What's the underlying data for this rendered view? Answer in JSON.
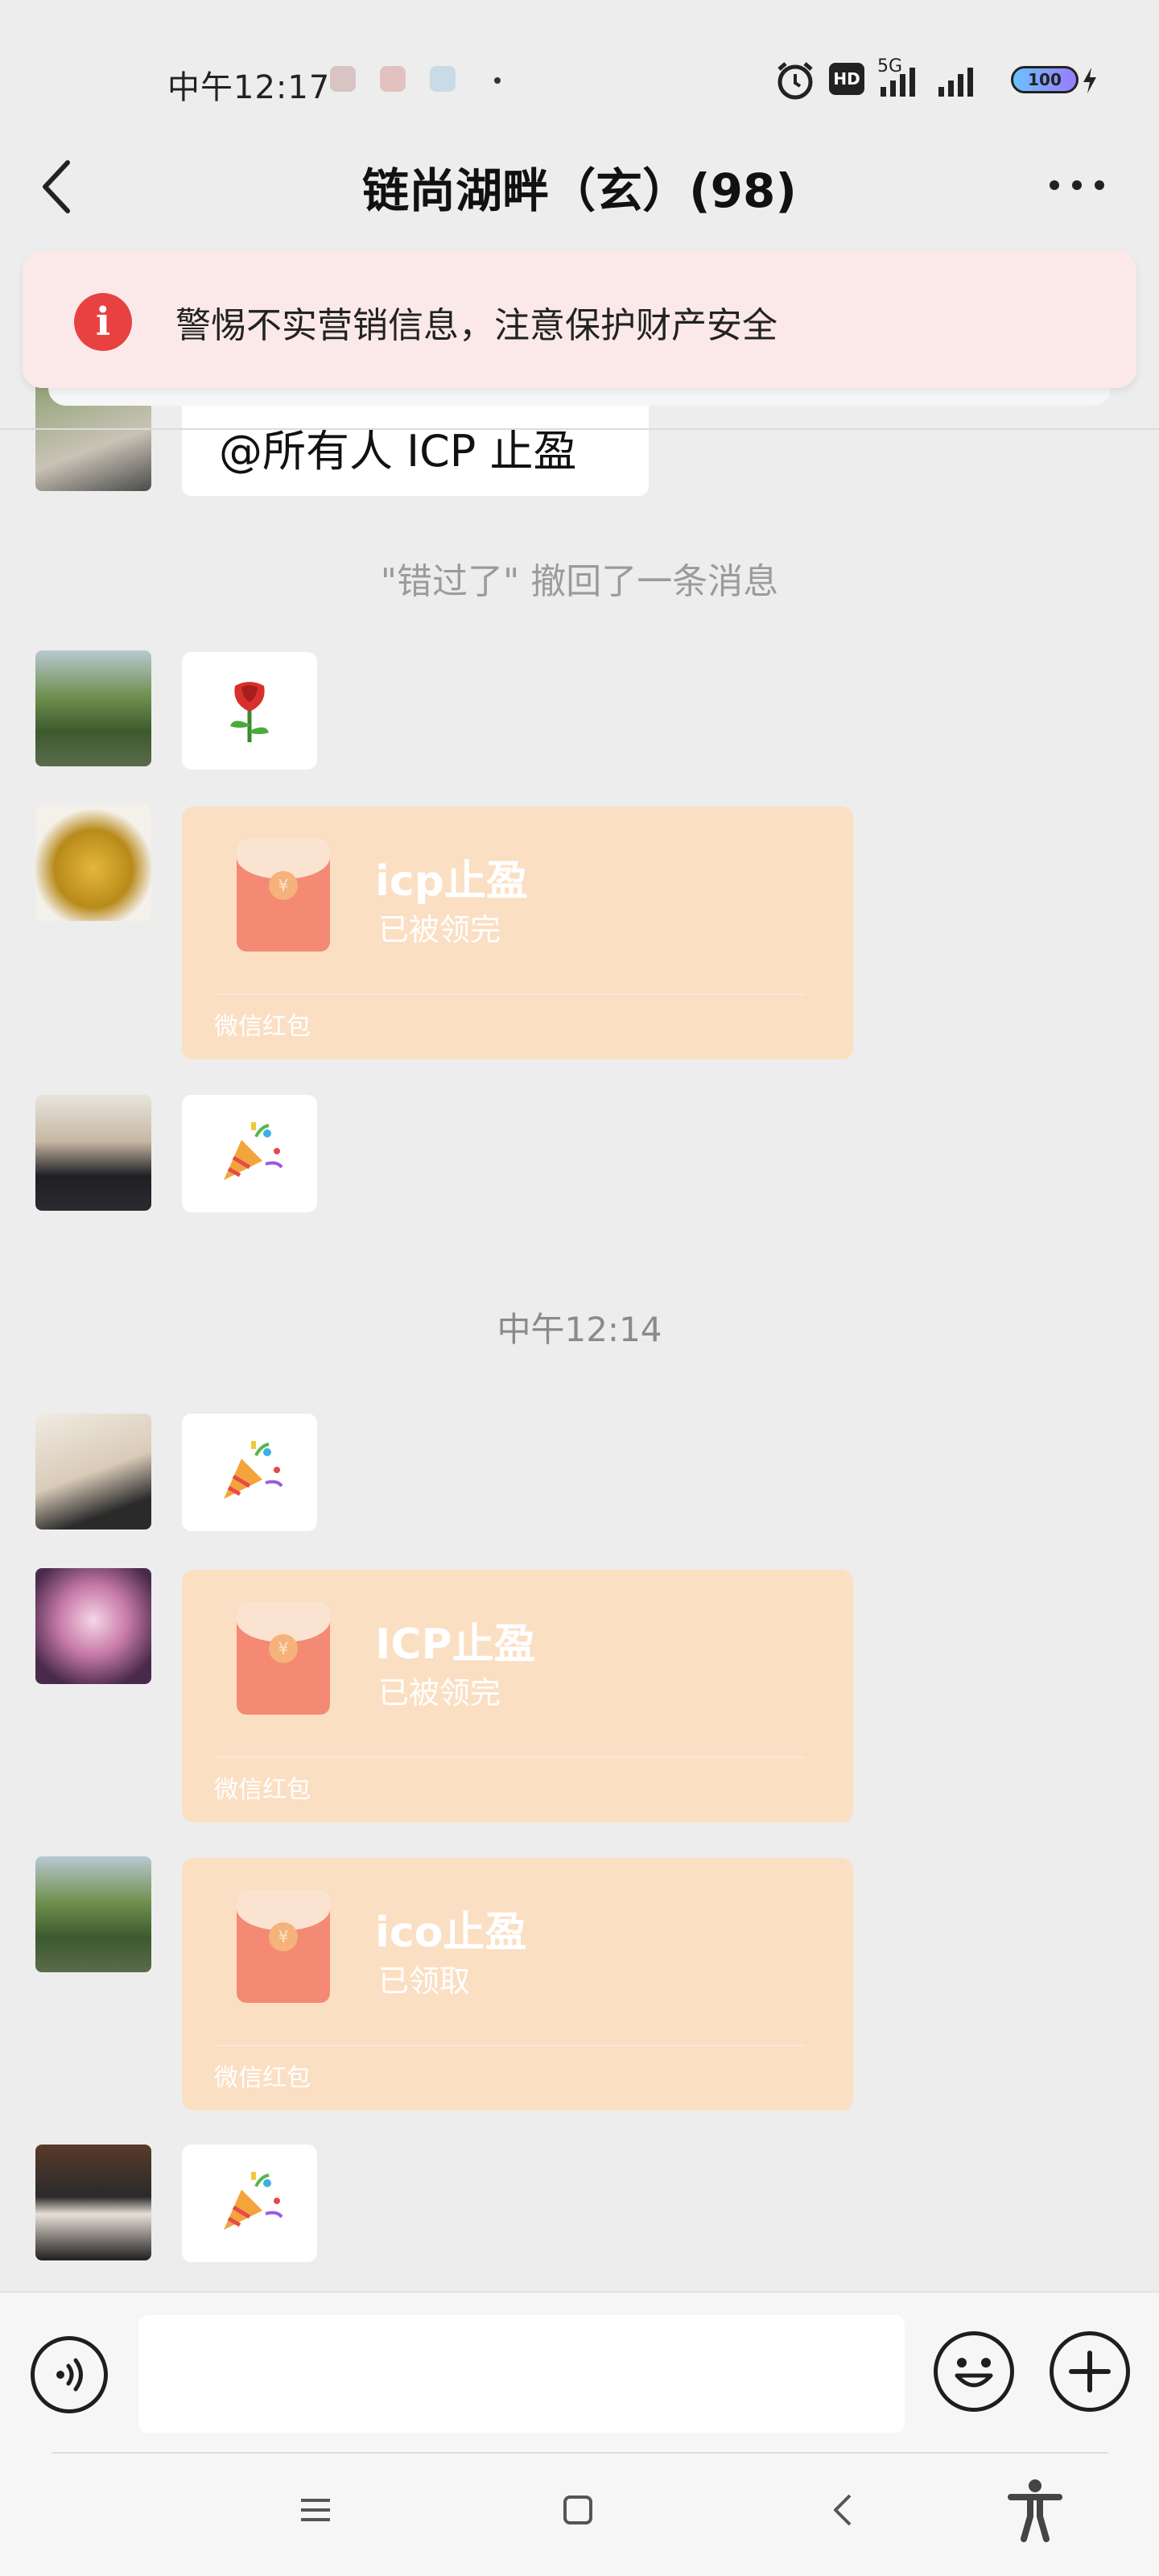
{
  "status_bar": {
    "time": "中午12:17",
    "network": "5G",
    "hd_label": "HD",
    "battery": "100"
  },
  "header": {
    "title": "链尚湖畔（玄）(98)"
  },
  "banner": {
    "text": "警惕不实营销信息，注意保护财产安全",
    "icon_label": "i"
  },
  "messages": {
    "partial_text": "@所有人 ICP 止盈",
    "recall_notice": "\"错过了\" 撤回了一条消息",
    "timestamp": "中午12:14",
    "red_packets": [
      {
        "title": "icp止盈",
        "status": "已被领完",
        "footer": "微信红包"
      },
      {
        "title": "ICP止盈",
        "status": "已被领完",
        "footer": "微信红包"
      },
      {
        "title": "ico止盈",
        "status": "已领取",
        "footer": "微信红包"
      }
    ],
    "envelope_symbol": "¥"
  },
  "icons": {
    "back": "back-arrow-icon",
    "more": "more-icon",
    "warning": "warning-icon",
    "rose": "rose-icon",
    "party": "party-popper-icon",
    "voice": "voice-icon",
    "emoji": "emoji-icon",
    "plus": "plus-icon",
    "menu": "menu-icon",
    "home": "home-icon",
    "nav_back": "nav-back-icon",
    "accessibility": "accessibility-icon"
  },
  "colors": {
    "background": "#ededed",
    "red_packet": "#fbdfc3",
    "envelope": "#f48a74",
    "warning_red": "#e84141",
    "banner_bg": "#fbe9e9"
  }
}
